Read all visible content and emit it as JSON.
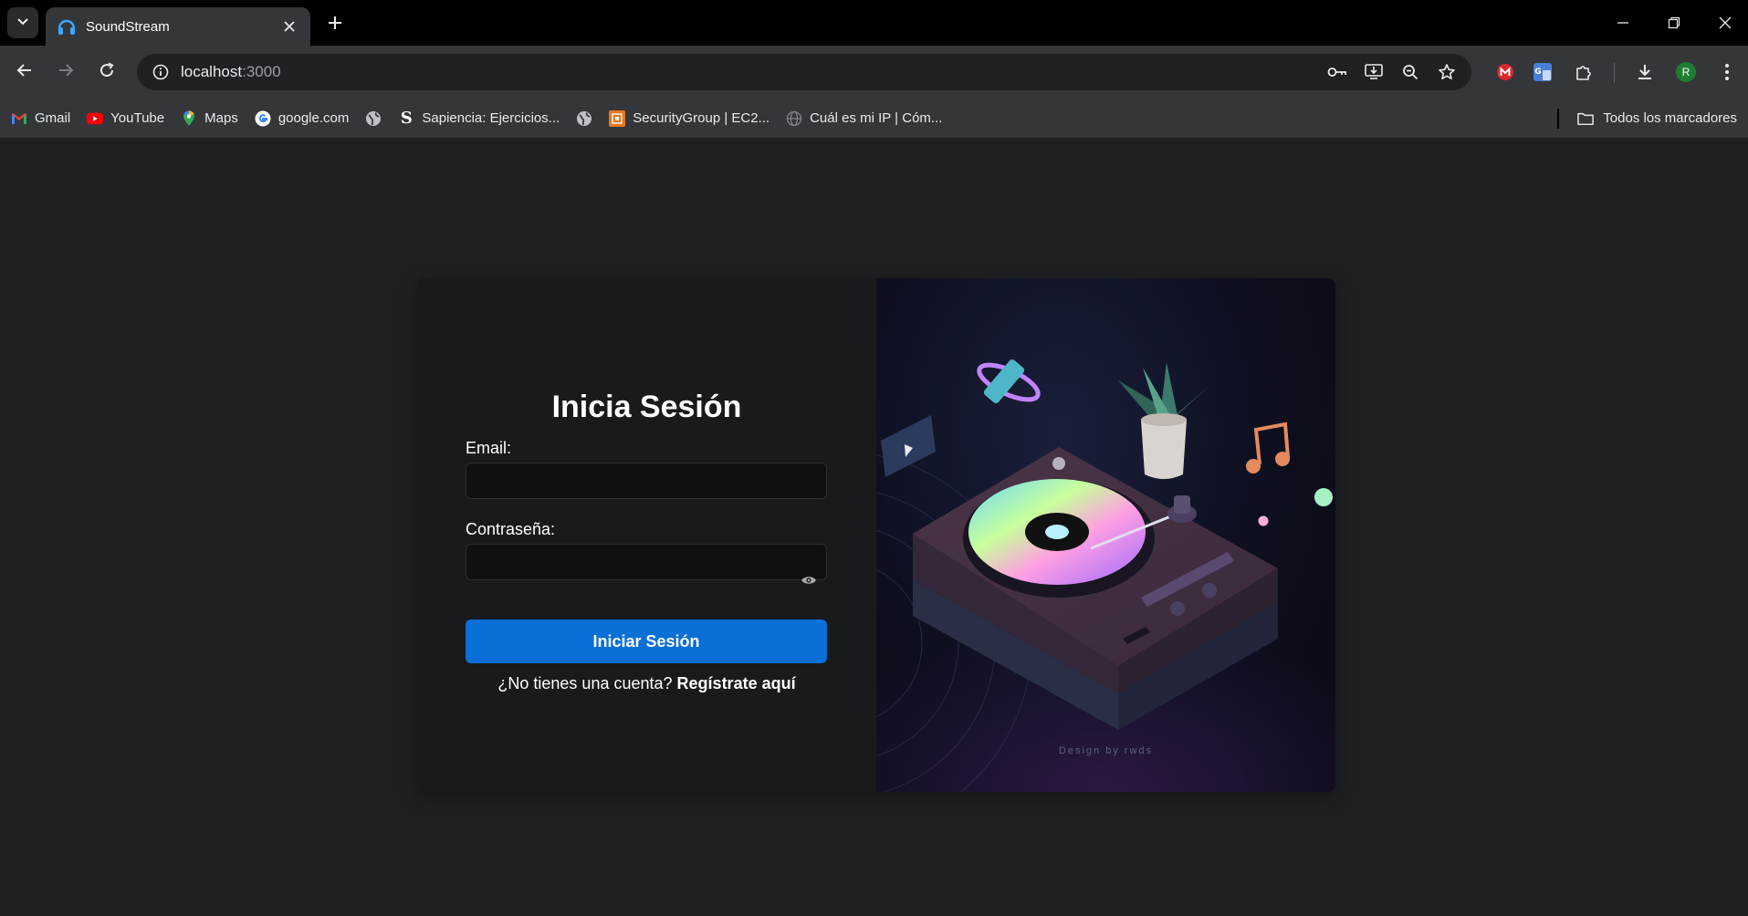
{
  "browser": {
    "tab": {
      "title": "SoundStream",
      "favicon": "headphones-icon"
    },
    "address": {
      "host": "localhost",
      "port": ":3000"
    },
    "bookmarks": [
      {
        "label": "Gmail",
        "icon": "gmail-icon"
      },
      {
        "label": "YouTube",
        "icon": "youtube-icon"
      },
      {
        "label": "Maps",
        "icon": "maps-icon"
      },
      {
        "label": "google.com",
        "icon": "google-icon"
      },
      {
        "label": "",
        "icon": "globe-icon"
      },
      {
        "label": "Sapiencia: Ejercicios...",
        "icon": "sapiencia-icon"
      },
      {
        "label": "",
        "icon": "globe-icon"
      },
      {
        "label": "SecurityGroup | EC2...",
        "icon": "aws-icon"
      },
      {
        "label": "Cuál es mi IP | Cóm...",
        "icon": "globe-icon"
      }
    ],
    "all_bookmarks": "Todos los marcadores",
    "profile_initial": "R"
  },
  "login": {
    "title": "Inicia Sesión",
    "email_label": "Email:",
    "email_value": "",
    "password_label": "Contraseña:",
    "password_value": "",
    "submit_label": "Iniciar Sesión",
    "register_prompt": "¿No tienes una cuenta?",
    "register_link": "Regístrate aquí"
  },
  "illustration": {
    "credit": "Design by rwds"
  },
  "colors": {
    "accent": "#0a6fd6",
    "page_bg": "#1f2023",
    "card_bg": "#191a1c"
  }
}
